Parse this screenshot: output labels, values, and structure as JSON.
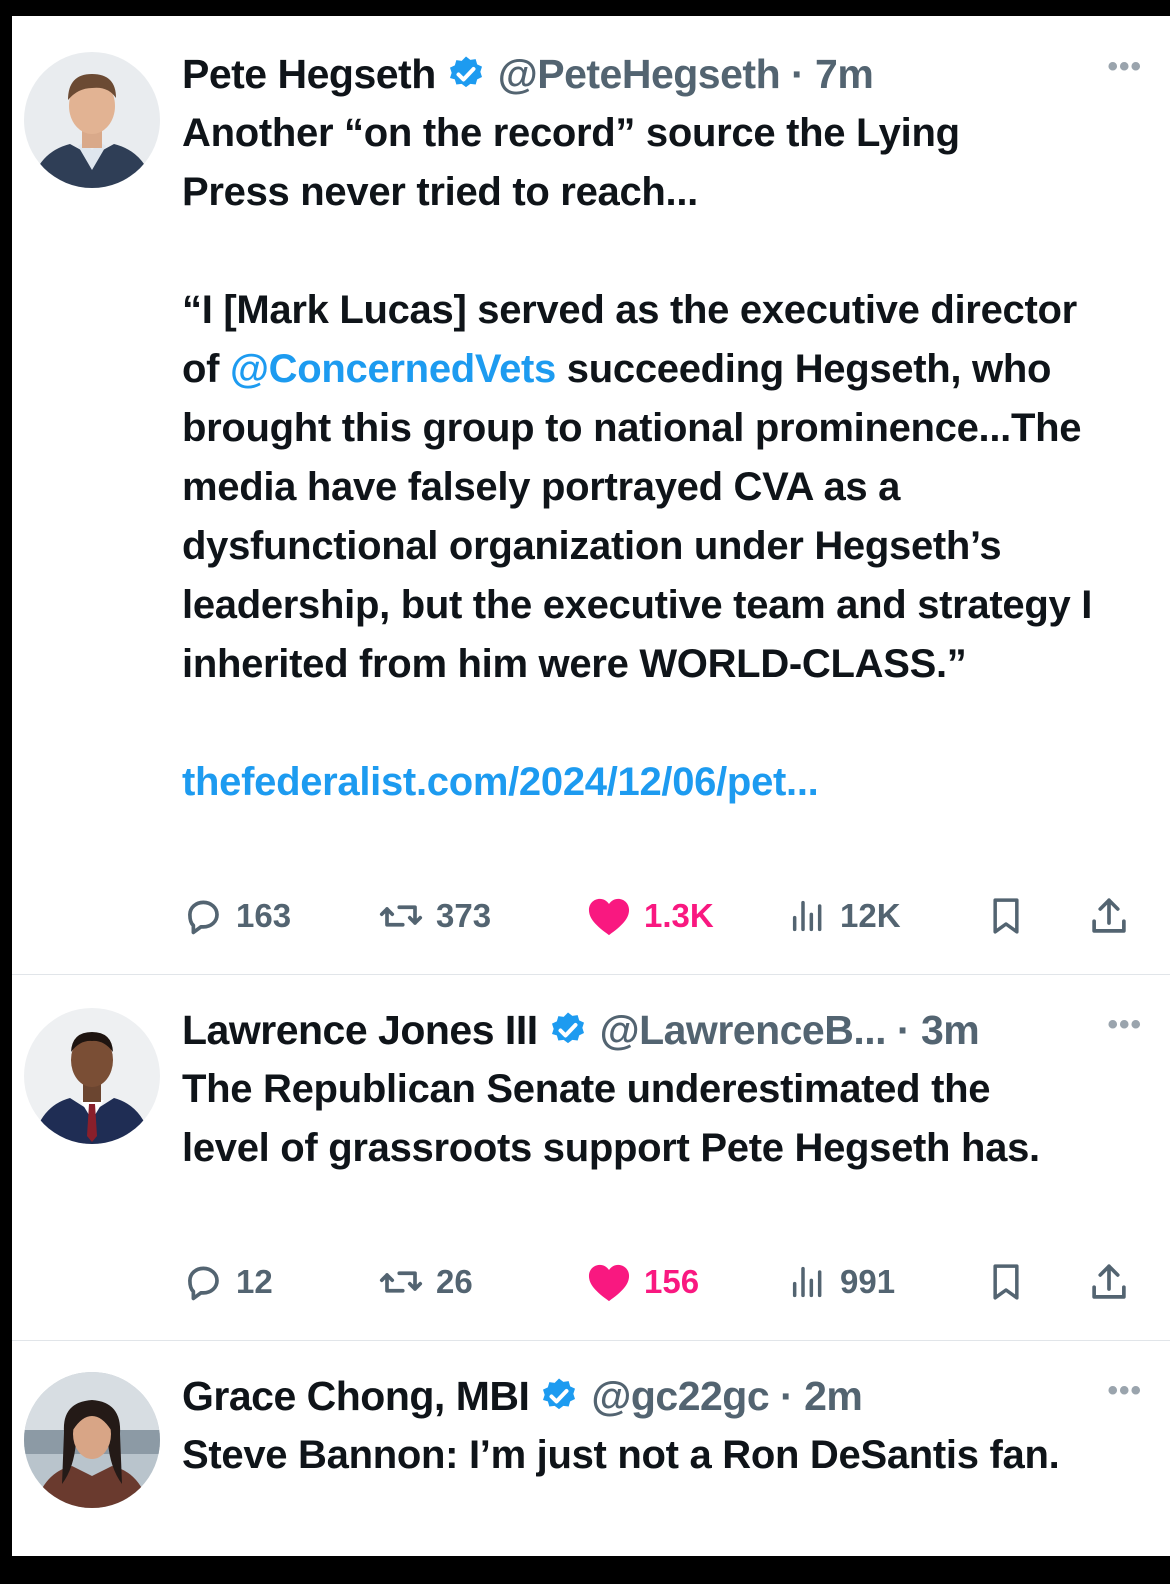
{
  "colors": {
    "link": "#1d9bf0",
    "like": "#f91880",
    "verified": "#1d9bf0",
    "muted": "#536471",
    "text": "#0f1419"
  },
  "tweets": [
    {
      "name": "Pete Hegseth",
      "handle": "@PeteHegseth",
      "time": "7m",
      "line1": "Another “on the record” source the Lying",
      "line2": "Press never tried to reach...",
      "quote_before": "“I [Mark Lucas] served as the executive director of ",
      "mention": "@ConcernedVets",
      "quote_after": " succeeding Hegseth, who brought this group to national prominence...The media have falsely portrayed CVA as a dysfunctional organization under Hegseth’s leadership, but the executive team and strategy I inherited from him were WORLD-CLASS.”",
      "url": "thefederalist.com/2024/12/06/pet...",
      "replies": "163",
      "reposts": "373",
      "likes": "1.3K",
      "views": "12K"
    },
    {
      "name": "Lawrence Jones III",
      "handle": "@LawrenceB...",
      "time": "3m",
      "text": "The Republican Senate underestimated the level of grassroots support Pete Hegseth has.",
      "replies": "12",
      "reposts": "26",
      "likes": "156",
      "views": "991"
    },
    {
      "name": "Grace Chong, MBI",
      "handle": "@gc22gc",
      "time": "2m",
      "text": "Steve Bannon: I’m just not a Ron DeSantis fan."
    }
  ],
  "icons": [
    "verified-badge-icon",
    "more-options-icon",
    "reply-icon",
    "repost-icon",
    "like-icon",
    "views-icon",
    "bookmark-icon",
    "share-icon"
  ]
}
